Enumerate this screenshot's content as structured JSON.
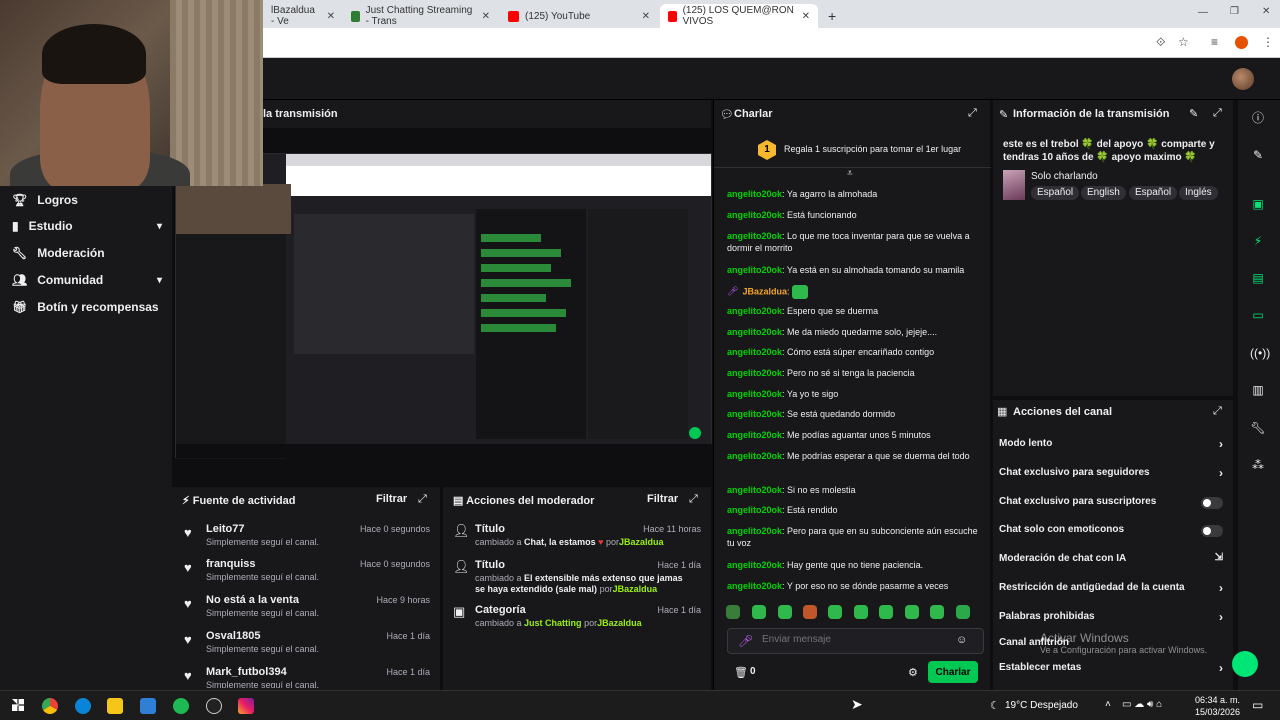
{
  "browser": {
    "tabs": [
      {
        "label": "lBazaldua - Ve",
        "color": "#6441a5"
      },
      {
        "label": "Just Chatting Streaming - Trans",
        "color": "#2e7d32"
      },
      {
        "label": "(125) YouTube",
        "color": "#ff0000"
      },
      {
        "label": "(125) LOS QUEM@RON VIVOS",
        "color": "#ff0000"
      }
    ],
    "new_tab": "+"
  },
  "sidebar": {
    "items": [
      {
        "label": "Logros",
        "expandable": false
      },
      {
        "label": "Estudio",
        "expandable": true
      },
      {
        "label": "Moderación",
        "expandable": false
      },
      {
        "label": "Comunidad",
        "expandable": true
      },
      {
        "label": "Botín y recompensas",
        "expandable": false
      }
    ]
  },
  "stream": {
    "header_title": "la transmisión"
  },
  "activity_feed": {
    "title": "Fuente de actividad",
    "filter_label": "Filtrar",
    "items": [
      {
        "name": "Leito77",
        "sub": "Simplemente seguí el canal.",
        "time": "Hace 0 segundos"
      },
      {
        "name": "franquiss",
        "sub": "Simplemente seguí el canal.",
        "time": "Hace 0 segundos"
      },
      {
        "name": "No está a la venta",
        "sub": "Simplemente seguí el canal.",
        "time": "Hace 9 horas"
      },
      {
        "name": "Osval1805",
        "sub": "Simplemente seguí el canal.",
        "time": "Hace 1 día"
      },
      {
        "name": "Mark_futbol394",
        "sub": "Simplemente seguí el canal.",
        "time": "Hace 1 día"
      }
    ]
  },
  "mod_actions": {
    "title": "Acciones del moderador",
    "filter_label": "Filtrar",
    "items": [
      {
        "title": "Título",
        "time": "Hace 11 horas",
        "prefix": "cambiado a",
        "value": "Chat, la estamos",
        "emoji": "♥",
        "by": "por",
        "user": "JBazaldua"
      },
      {
        "title": "Título",
        "time": "Hace 1 día",
        "prefix": "cambiado a",
        "value": "El extensible más extenso que jamas se haya extendido (sale mal)",
        "emoji": "",
        "by": "por",
        "user": "JBazaldua"
      },
      {
        "title": "Categoría",
        "time": "Hace 1 día",
        "prefix": "cambiado a",
        "value": "Just Chatting",
        "emoji": "",
        "by": "por",
        "user": "JBazaldua"
      }
    ]
  },
  "chat": {
    "title": "Charlar",
    "pinned": "Regala 1 suscripción para tomar el 1er lugar",
    "pinned_badge": "1",
    "messages": [
      {
        "user": "angelito20ok",
        "text": "Ya agarro la almohada"
      },
      {
        "user": "angelito20ok",
        "text": "Está funcionando"
      },
      {
        "user": "angelito20ok",
        "text": "Lo que me toca inventar para que se vuelva a dormir el morrito"
      },
      {
        "user": "angelito20ok",
        "text": "Ya está en su almohada tomando su mamila"
      },
      {
        "user": "JBazaldua",
        "text": "",
        "special": true
      },
      {
        "user": "angelito20ok",
        "text": "Espero que se duerma"
      },
      {
        "user": "angelito20ok",
        "text": "Me da miedo quedarme solo, jejeje...."
      },
      {
        "user": "angelito20ok",
        "text": "Cómo está súper encariñado contigo"
      },
      {
        "user": "angelito20ok",
        "text": "Pero no sé si tenga la paciencia"
      },
      {
        "user": "angelito20ok",
        "text": "Ya yo te sigo"
      },
      {
        "user": "angelito20ok",
        "text": "Se está quedando dormido"
      },
      {
        "user": "angelito20ok",
        "text": "Me podías aguantar unos 5 minutos"
      },
      {
        "user": "angelito20ok",
        "text": "Me podrías esperar a que se duerma del todo"
      },
      {
        "user": "angelito20ok",
        "text": "Si no es molestia"
      },
      {
        "user": "angelito20ok",
        "text": "Está rendido"
      },
      {
        "user": "angelito20ok",
        "text": "Pero para que en su subconciente aún escuche tu voz"
      },
      {
        "user": "angelito20ok",
        "text": "Hay gente que no tiene paciencia."
      },
      {
        "user": "angelito20ok",
        "text": "Y por eso no se dónde pasarme a veces"
      }
    ],
    "input_placeholder": "Enviar mensaje",
    "send_label": "Charlar",
    "points": "0"
  },
  "stream_info": {
    "title": "Información de la transmisión",
    "description": "este es el trebol 🍀 del apoyo 🍀 comparte y tendras 10 años de 🍀 apoyo maximo 🍀",
    "category": "Solo charlando",
    "tags": [
      "Español",
      "English",
      "Español",
      "Inglés"
    ]
  },
  "channel_actions": {
    "title": "Acciones del canal",
    "items": [
      {
        "label": "Modo lento",
        "control": "chevron"
      },
      {
        "label": "Chat exclusivo para seguidores",
        "control": "chevron"
      },
      {
        "label": "Chat exclusivo para suscriptores",
        "control": "toggle"
      },
      {
        "label": "Chat solo con emoticonos",
        "control": "toggle"
      },
      {
        "label": "Moderación de chat con IA",
        "control": "external"
      },
      {
        "label": "Restricción de antigüedad de la cuenta",
        "control": "chevron"
      },
      {
        "label": "Palabras prohibidas",
        "control": "chevron"
      },
      {
        "label": "Canal anfitrión",
        "control": "chevron"
      },
      {
        "label": "Establecer metas",
        "control": "chevron"
      }
    ]
  },
  "watermark": {
    "title": "Activar Windows",
    "sub": "Ve a Configuración para activar Windows."
  },
  "taskbar": {
    "weather": "19°C Despejado",
    "time": "06:34 a. m.",
    "date": "15/03/2026"
  }
}
